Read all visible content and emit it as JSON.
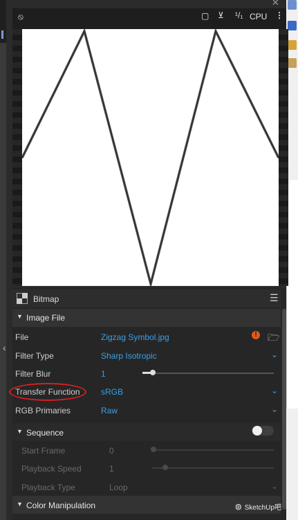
{
  "toolbar": {
    "ratio": "¹/₁",
    "device": "CPU",
    "more": "⋮"
  },
  "panel": {
    "title": "Bitmap",
    "image_file_section": "Image File",
    "rows": {
      "file": {
        "label": "File",
        "value": "Zigzag Symbol.jpg"
      },
      "filter_type": {
        "label": "Filter Type",
        "value": "Sharp Isotropic"
      },
      "filter_blur": {
        "label": "Filter Blur",
        "value": "1",
        "slider_level": 0.08
      },
      "transfer_function": {
        "label": "Transfer Function",
        "value": "sRGB"
      },
      "rgb_primaries": {
        "label": "RGB Primaries",
        "value": "Raw"
      }
    },
    "sequence_section": "Sequence",
    "sequence_enabled": false,
    "sequence_rows": {
      "start_frame": {
        "label": "Start Frame",
        "value": "0"
      },
      "playback_speed": {
        "label": "Playback Speed",
        "value": "1"
      },
      "playback_type": {
        "label": "Playback Type",
        "value": "Loop"
      }
    },
    "color_manipulation_section": "Color Manipulation"
  },
  "watermark": {
    "text": "SketchUp吧"
  },
  "colors": {
    "accent": "#3aa0e8",
    "warning": "#e05a1a",
    "annotation": "#d61f1f"
  }
}
